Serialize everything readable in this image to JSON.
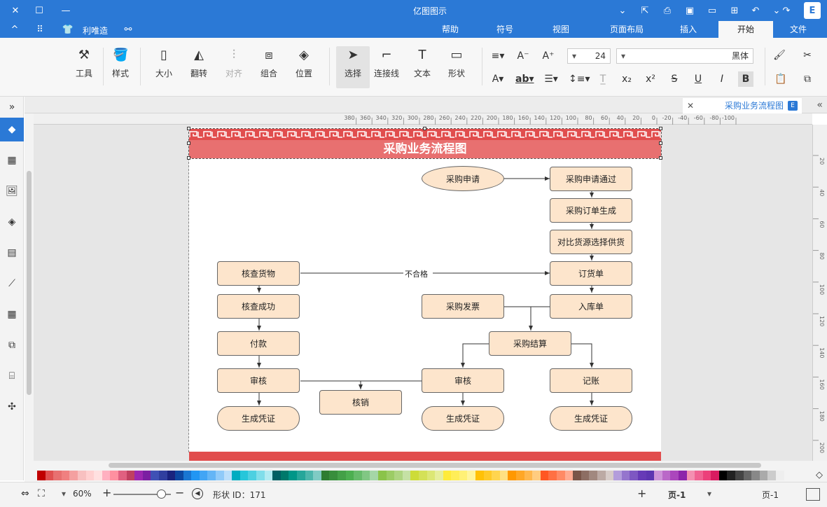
{
  "app": {
    "title": "亿图图示"
  },
  "menu_tabs": [
    "文件",
    "开始",
    "插入",
    "页面布局",
    "视图",
    "符号",
    "帮助"
  ],
  "active_tab": "开始",
  "title_left": {
    "brand": "利唯造"
  },
  "ribbon": {
    "font_name": "黑体",
    "font_size": "24",
    "buttons": {
      "shape": "形状",
      "text": "文本",
      "connector": "连接线",
      "select": "选择",
      "position": "位置",
      "group": "组合",
      "align": "对齐",
      "flip": "翻转",
      "size": "大小",
      "style": "样式",
      "tools": "工具"
    }
  },
  "doc_tab": {
    "label": "采购业务流程图"
  },
  "ruler_h_labels": [
    "-100",
    "-80",
    "-60",
    "-40",
    "-20",
    "0",
    "20",
    "40",
    "60",
    "80",
    "100",
    "120",
    "140",
    "160",
    "180",
    "200",
    "220",
    "240",
    "260",
    "280",
    "300",
    "320",
    "340",
    "360",
    "380"
  ],
  "ruler_v_labels": [
    "20",
    "40",
    "60",
    "80",
    "100",
    "120",
    "140",
    "160",
    "180",
    "200"
  ],
  "diagram": {
    "title": "采购业务流程图",
    "nodes": {
      "n_apply": "采购申请",
      "n_approve": "采购申请通过",
      "n_order": "采购订单生成",
      "n_compare": "对比货源选择供货",
      "n_purchase": "订货单",
      "n_inbound": "入库单",
      "n_invoice": "采购发票",
      "n_settle": "采购结算",
      "n_book": "记账",
      "n_audit_mid": "审核",
      "n_cancel": "核销",
      "n_cert_right": "生成凭证",
      "n_cert_mid": "生成凭证",
      "n_check_goods": "核查货物",
      "n_check_ok": "核查成功",
      "n_pay": "付款",
      "n_audit_left": "审核",
      "n_cert_left": "生成凭证"
    },
    "edge_label_fail": "不合格"
  },
  "palette_colors": [
    "#c00000",
    "#e05050",
    "#e87070",
    "#f08080",
    "#f4a0a0",
    "#f8c0c0",
    "#ffd0d0",
    "#ffe0e0",
    "#ffb0c0",
    "#ff90a0",
    "#e06080",
    "#c04060",
    "#9c27b0",
    "#7b1fa2",
    "#3f51b5",
    "#303f9f",
    "#1a237e",
    "#0d47a1",
    "#1976d2",
    "#2196f3",
    "#42a5f5",
    "#64b5f6",
    "#90caf9",
    "#bbdefb",
    "#00acc1",
    "#26c6da",
    "#4dd0e1",
    "#80deea",
    "#b2ebf2",
    "#006064",
    "#00796b",
    "#009688",
    "#26a69a",
    "#4db6ac",
    "#80cbc4",
    "#2e7d32",
    "#388e3c",
    "#43a047",
    "#4caf50",
    "#66bb6a",
    "#81c784",
    "#a5d6a7",
    "#8bc34a",
    "#9ccc65",
    "#aed581",
    "#c5e1a5",
    "#cddc39",
    "#d4e157",
    "#dce775",
    "#e6ee9c",
    "#ffeb3b",
    "#ffee58",
    "#fff176",
    "#fff59d",
    "#ffc107",
    "#ffca28",
    "#ffd54f",
    "#ffe082",
    "#ff9800",
    "#ffa726",
    "#ffb74d",
    "#ffcc80",
    "#ff5722",
    "#ff7043",
    "#ff8a65",
    "#ffab91",
    "#795548",
    "#8d6e63",
    "#a1887f",
    "#bcaaa4",
    "#d7ccc8",
    "#b39ddb",
    "#9575cd",
    "#7e57c2",
    "#673ab7",
    "#5e35b1",
    "#ce93d8",
    "#ba68c8",
    "#ab47bc",
    "#8e24aa",
    "#f48fb1",
    "#f06292",
    "#ec407a",
    "#d81b60",
    "#000000",
    "#222222",
    "#444444",
    "#666666",
    "#888888",
    "#aaaaaa",
    "#cccccc",
    "#eeeeee"
  ],
  "status": {
    "page_select": "页-1",
    "page_tab": "页-1",
    "add_page": "+",
    "shape_id": "形状 ID：171",
    "zoom": "60%"
  }
}
